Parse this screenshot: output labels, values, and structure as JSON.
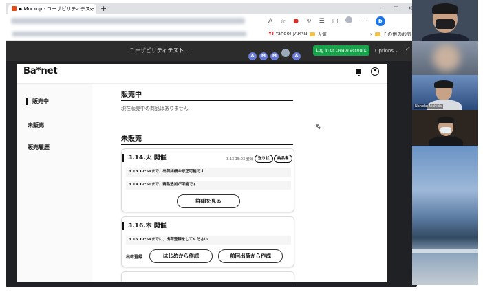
{
  "browser": {
    "tab_title": "▶ Mockup - ユーザビリティテスト（",
    "tab_close": "×",
    "new_tab": "+",
    "window_controls": [
      "−",
      "□",
      "×"
    ],
    "bookmarks": {
      "yahoo": "Yahoo! JAPAN",
      "weather": "天気",
      "chevron": "›",
      "other": "その他のお気に入"
    }
  },
  "figma": {
    "file_title": "ユーザビリティテスト...",
    "avatars": [
      "A",
      "M",
      "M",
      "",
      "A"
    ],
    "login_button": "Log in or create account",
    "options": "Options ⌄"
  },
  "app": {
    "logo": "Ba*net",
    "sidebar": [
      {
        "label": "販売中",
        "active": true
      },
      {
        "label": "未販売",
        "active": false
      },
      {
        "label": "販売履歴",
        "active": false
      }
    ],
    "on_sale": {
      "heading": "販売中",
      "empty_message": "現在販売中の商品はありません"
    },
    "not_on_sale": {
      "heading": "未販売",
      "cards": [
        {
          "title": "3.14.火 開催",
          "registered": "3.13 15:03 登録",
          "badges": [
            "送り状",
            "納品書"
          ],
          "info": [
            "3.13 17:59まで、出荷詳細の修正可能です",
            "3.14 12:50まで、商品追加が可能です"
          ],
          "detail_button": "詳細を見る"
        },
        {
          "title": "3.16.木 開催",
          "info": [
            "3.15 17:59までに、出荷登録をしてください"
          ],
          "register_label": "出荷登録",
          "create_new_button": "はじめから作成",
          "copy_previous_button": "前回出荷から作成"
        }
      ]
    }
  },
  "participants": [
    {
      "name": ""
    },
    {
      "name": ""
    },
    {
      "name": "Nahoko Nishida"
    },
    {
      "name": ""
    },
    {
      "name": ""
    }
  ]
}
